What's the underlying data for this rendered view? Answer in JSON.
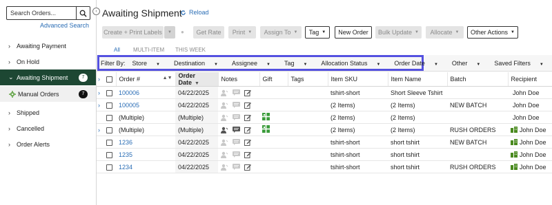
{
  "sidebar": {
    "search_placeholder": "Search Orders...",
    "advanced_search": "Advanced Search",
    "items": [
      {
        "label": "Awaiting Payment"
      },
      {
        "label": "On Hold"
      },
      {
        "label": "Awaiting Shipment",
        "count": "7"
      },
      {
        "label": "Manual Orders",
        "count": "7"
      },
      {
        "label": "Shipped"
      },
      {
        "label": "Cancelled"
      },
      {
        "label": "Order Alerts"
      }
    ]
  },
  "header": {
    "title": "Awaiting Shipment",
    "reload": "Reload"
  },
  "toolbar": {
    "create_print": "Create + Print Labels",
    "get_rate": "Get Rate",
    "print": "Print",
    "assign_to": "Assign To",
    "tag": "Tag",
    "new_order": "New Order",
    "bulk_update": "Bulk Update",
    "allocate": "Allocate",
    "other_actions": "Other Actions"
  },
  "tabs": [
    "All",
    "MULTI-ITEM",
    "THIS WEEK"
  ],
  "filters": {
    "label": "Filter By:",
    "items": [
      "Store",
      "Destination",
      "Assignee",
      "Tag",
      "Allocation Status",
      "Order Date",
      "Other",
      "Saved Filters"
    ]
  },
  "table": {
    "columns": [
      "Order #",
      "Order Date",
      "Notes",
      "Gift",
      "Tags",
      "Item SKU",
      "Item Name",
      "Batch",
      "Recipient"
    ],
    "rows": [
      {
        "order": "100006",
        "date": "04/22/2025",
        "sku": "tshirt-short",
        "name": "Short Sleeve Tshirt",
        "batch": "",
        "recipient": "John Doe"
      },
      {
        "order": "100005",
        "date": "04/22/2025",
        "sku": "(2 Items)",
        "name": "(2 Items)",
        "batch": "NEW BATCH",
        "recipient": "John Doe"
      },
      {
        "order": "(Multiple)",
        "date": "(Multiple)",
        "sku": "(2 Items)",
        "name": "(2 Items)",
        "batch": "",
        "recipient": "John Doe"
      },
      {
        "order": "(Multiple)",
        "date": "(Multiple)",
        "sku": "(2 Items)",
        "name": "(2 Items)",
        "batch": "RUSH ORDERS",
        "recipient": "John Doe"
      },
      {
        "order": "1236",
        "date": "04/22/2025",
        "sku": "tshirt-short",
        "name": "short tshirt",
        "batch": "NEW BATCH",
        "recipient": "John Doe"
      },
      {
        "order": "1235",
        "date": "04/22/2025",
        "sku": "tshirt-short",
        "name": "short tshirt",
        "batch": "",
        "recipient": "John Doe"
      },
      {
        "order": "1234",
        "date": "04/22/2025",
        "sku": "tshirt-short",
        "name": "short tshirt",
        "batch": "RUSH ORDERS",
        "recipient": "John Doe"
      }
    ]
  },
  "colors": {
    "sidebar_active": "#1d4733",
    "link": "#2a6db5",
    "highlight": "#5451e0",
    "gift_green": "#3a9b3a"
  }
}
